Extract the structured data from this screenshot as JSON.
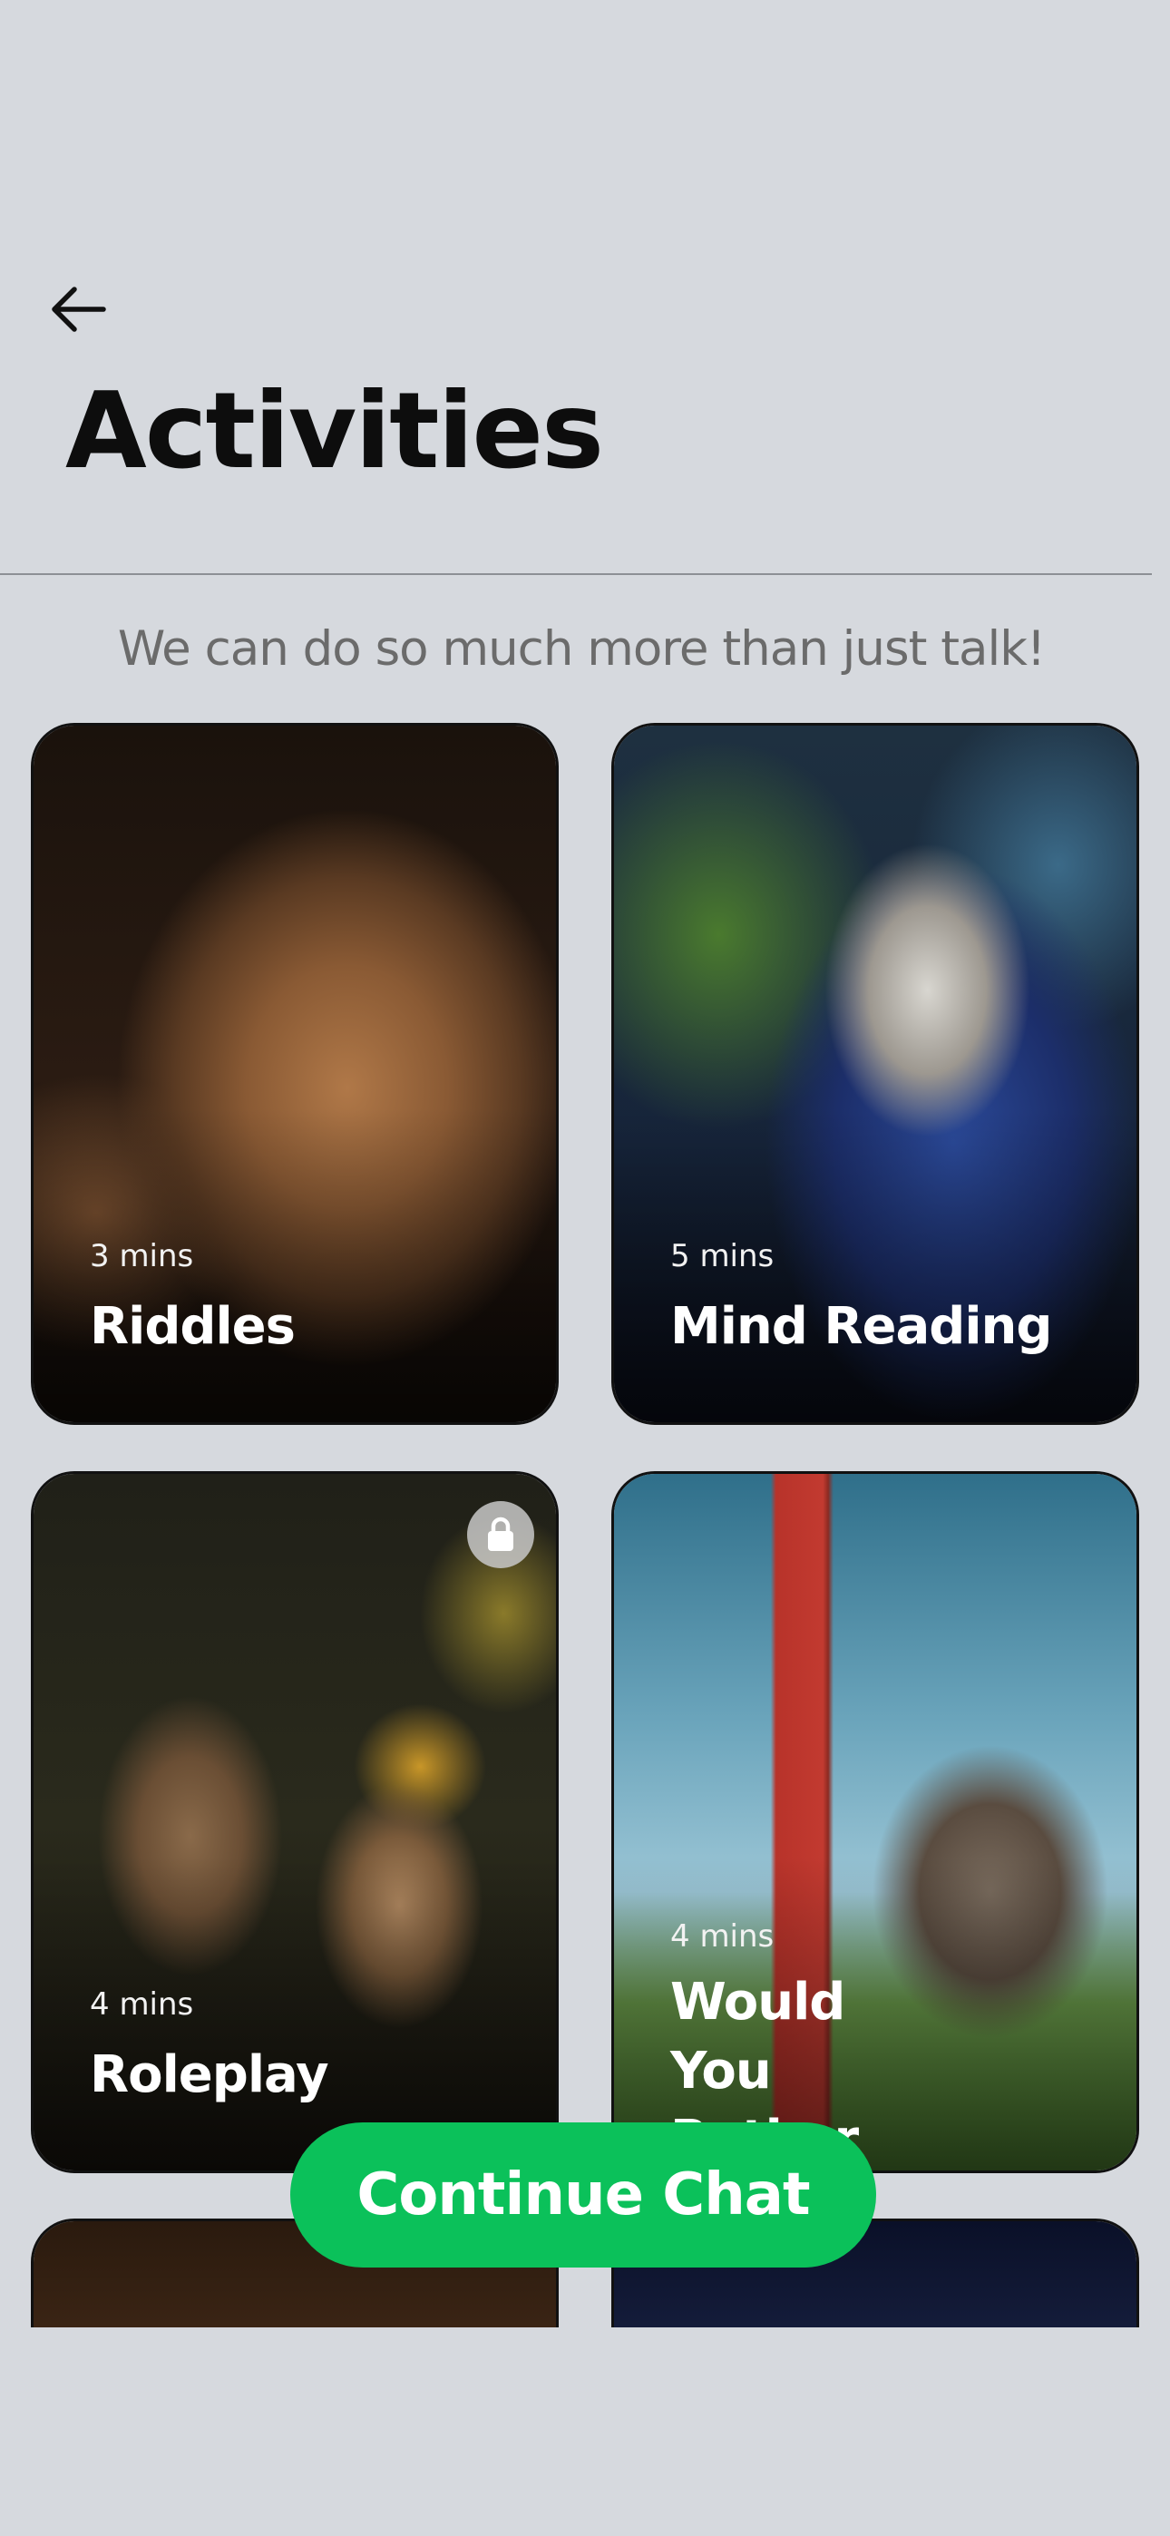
{
  "header": {
    "back_icon": "arrow-left-icon",
    "title": "Activities"
  },
  "subtitle": "We can do so much more than just talk!",
  "activities": [
    {
      "duration": "3 mins",
      "name": "Riddles",
      "locked": false
    },
    {
      "duration": "5 mins",
      "name": "Mind Reading",
      "locked": false
    },
    {
      "duration": "4 mins",
      "name": "Roleplay",
      "locked": true,
      "lock_icon": "lock-icon"
    },
    {
      "duration": "4 mins",
      "name": "Would You Rather",
      "locked": false
    }
  ],
  "continue_button": {
    "label": "Continue Chat",
    "color": "#0bc15a"
  },
  "colors": {
    "background": "#d6d9de",
    "accent": "#0bc15a"
  }
}
